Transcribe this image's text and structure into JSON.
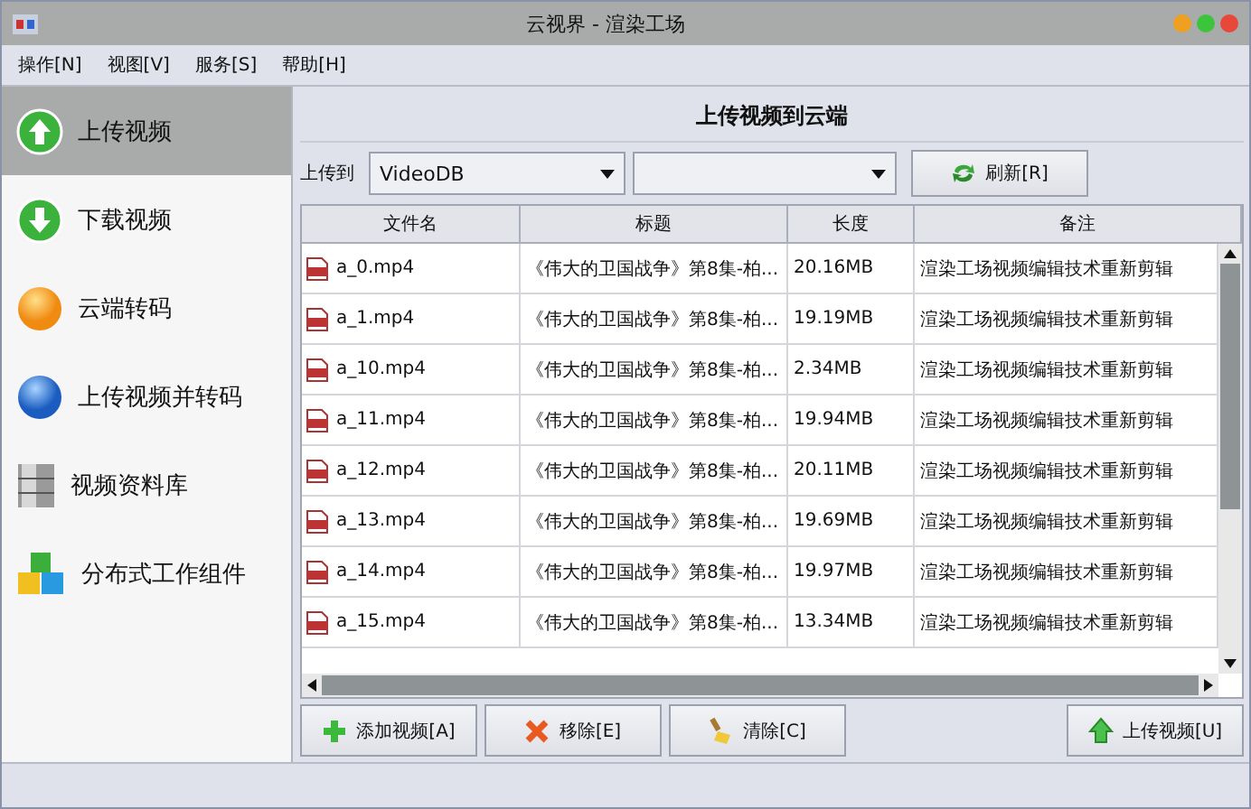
{
  "window": {
    "title": "云视界 - 渲染工场"
  },
  "menu": [
    "操作[N]",
    "视图[V]",
    "服务[S]",
    "帮助[H]"
  ],
  "sidebar": {
    "items": [
      {
        "label": "上传视频",
        "selected": true
      },
      {
        "label": "下载视频",
        "selected": false
      },
      {
        "label": "云端转码",
        "selected": false
      },
      {
        "label": "上传视频并转码",
        "selected": false
      },
      {
        "label": "视频资料库",
        "selected": false
      },
      {
        "label": "分布式工作组件",
        "selected": false
      }
    ]
  },
  "panel": {
    "heading": "上传视频到云端",
    "target_label": "上传到",
    "target_value": "VideoDB",
    "refresh_button": "刷新[R]"
  },
  "table": {
    "columns": [
      "文件名",
      "标题",
      "长度",
      "备注"
    ],
    "rows": [
      [
        "a_0.mp4",
        "《伟大的卫国战争》第8集-柏...",
        "20.16MB",
        "渲染工场视频编辑技术重新剪辑"
      ],
      [
        "a_1.mp4",
        "《伟大的卫国战争》第8集-柏...",
        "19.19MB",
        "渲染工场视频编辑技术重新剪辑"
      ],
      [
        "a_10.mp4",
        "《伟大的卫国战争》第8集-柏...",
        "2.34MB",
        "渲染工场视频编辑技术重新剪辑"
      ],
      [
        "a_11.mp4",
        "《伟大的卫国战争》第8集-柏...",
        "19.94MB",
        "渲染工场视频编辑技术重新剪辑"
      ],
      [
        "a_12.mp4",
        "《伟大的卫国战争》第8集-柏...",
        "20.11MB",
        "渲染工场视频编辑技术重新剪辑"
      ],
      [
        "a_13.mp4",
        "《伟大的卫国战争》第8集-柏...",
        "19.69MB",
        "渲染工场视频编辑技术重新剪辑"
      ],
      [
        "a_14.mp4",
        "《伟大的卫国战争》第8集-柏...",
        "19.97MB",
        "渲染工场视频编辑技术重新剪辑"
      ],
      [
        "a_15.mp4",
        "《伟大的卫国战争》第8集-柏...",
        "13.34MB",
        "渲染工场视频编辑技术重新剪辑"
      ]
    ]
  },
  "buttons": [
    {
      "kind": "add",
      "label": "添加视频[A]"
    },
    {
      "kind": "remove",
      "label": "移除[E]"
    },
    {
      "kind": "clear",
      "label": "清除[C]"
    },
    {
      "kind": "upload",
      "label": "上传视频[U]"
    }
  ]
}
